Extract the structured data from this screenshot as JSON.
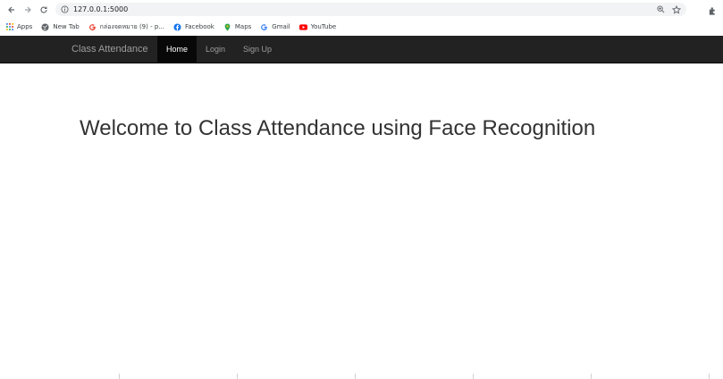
{
  "browser": {
    "url": "127.0.0.1:5000",
    "bookmarks": [
      {
        "label": "Apps",
        "icon": "apps-grid-icon"
      },
      {
        "label": "New Tab",
        "icon": "globe-icon"
      },
      {
        "label": "กล่องจดหมาย (9) - p...",
        "icon": "google-g-icon"
      },
      {
        "label": "Facebook",
        "icon": "facebook-icon"
      },
      {
        "label": "Maps",
        "icon": "maps-pin-icon"
      },
      {
        "label": "Gmail",
        "icon": "google-g-icon"
      },
      {
        "label": "YouTube",
        "icon": "youtube-icon"
      }
    ]
  },
  "navbar": {
    "brand": "Class Attendance",
    "items": [
      {
        "label": "Home",
        "active": true
      },
      {
        "label": "Login",
        "active": false
      },
      {
        "label": "Sign Up",
        "active": false
      }
    ]
  },
  "main": {
    "heading": "Welcome to Class Attendance using Face Recognition"
  },
  "colors": {
    "navbar_bg": "#222222",
    "active_bg": "#080808",
    "nav_text": "#9d9d9d",
    "heading": "#333333"
  }
}
